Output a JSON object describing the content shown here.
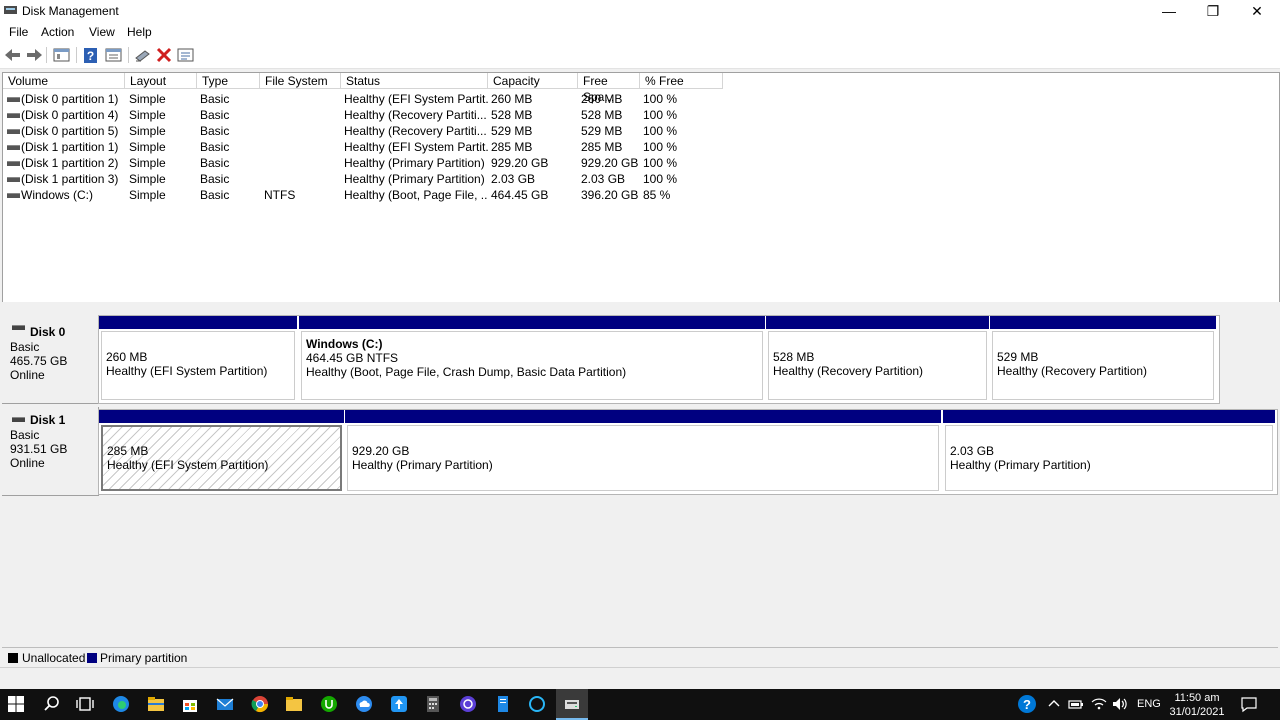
{
  "window": {
    "title": "Disk Management",
    "minimize": "—",
    "restore": "❐",
    "close": "✕"
  },
  "menu": [
    "File",
    "Action",
    "View",
    "Help"
  ],
  "toolbar_icons": [
    "back-icon",
    "forward-icon",
    "console-tree-icon",
    "help-icon",
    "properties-icon",
    "connect-icon",
    "delete-icon",
    "settings-icon"
  ],
  "columns": [
    "Volume",
    "Layout",
    "Type",
    "File System",
    "Status",
    "Capacity",
    "Free Spa...",
    "% Free"
  ],
  "volumes": [
    {
      "volume": "(Disk 0 partition 1)",
      "layout": "Simple",
      "type": "Basic",
      "fs": "",
      "status": "Healthy (EFI System Partit...",
      "capacity": "260 MB",
      "free": "260 MB",
      "pct": "100 %"
    },
    {
      "volume": "(Disk 0 partition 4)",
      "layout": "Simple",
      "type": "Basic",
      "fs": "",
      "status": "Healthy (Recovery Partiti...",
      "capacity": "528 MB",
      "free": "528 MB",
      "pct": "100 %"
    },
    {
      "volume": "(Disk 0 partition 5)",
      "layout": "Simple",
      "type": "Basic",
      "fs": "",
      "status": "Healthy (Recovery Partiti...",
      "capacity": "529 MB",
      "free": "529 MB",
      "pct": "100 %"
    },
    {
      "volume": "(Disk 1 partition 1)",
      "layout": "Simple",
      "type": "Basic",
      "fs": "",
      "status": "Healthy (EFI System Partit...",
      "capacity": "285 MB",
      "free": "285 MB",
      "pct": "100 %"
    },
    {
      "volume": "(Disk 1 partition 2)",
      "layout": "Simple",
      "type": "Basic",
      "fs": "",
      "status": "Healthy (Primary Partition)",
      "capacity": "929.20 GB",
      "free": "929.20 GB",
      "pct": "100 %"
    },
    {
      "volume": "(Disk 1 partition 3)",
      "layout": "Simple",
      "type": "Basic",
      "fs": "",
      "status": "Healthy (Primary Partition)",
      "capacity": "2.03 GB",
      "free": "2.03 GB",
      "pct": "100 %"
    },
    {
      "volume": "Windows (C:)",
      "layout": "Simple",
      "type": "Basic",
      "fs": "NTFS",
      "status": "Healthy (Boot, Page File, ...",
      "capacity": "464.45 GB",
      "free": "396.20 GB",
      "pct": "85 %"
    }
  ],
  "disks": [
    {
      "name": "Disk 0",
      "type": "Basic",
      "size": "465.75 GB",
      "state": "Online",
      "partitions": [
        {
          "title": "",
          "size": "260 MB",
          "status": "Healthy (EFI System Partition)"
        },
        {
          "title": "Windows  (C:)",
          "size": "464.45 GB NTFS",
          "status": "Healthy (Boot, Page File, Crash Dump, Basic Data Partition)"
        },
        {
          "title": "",
          "size": "528 MB",
          "status": "Healthy (Recovery Partition)"
        },
        {
          "title": "",
          "size": "529 MB",
          "status": "Healthy (Recovery Partition)"
        }
      ]
    },
    {
      "name": "Disk 1",
      "type": "Basic",
      "size": "931.51 GB",
      "state": "Online",
      "partitions": [
        {
          "title": "",
          "size": "285 MB",
          "status": "Healthy (EFI System Partition)",
          "selected": true
        },
        {
          "title": "",
          "size": "929.20 GB",
          "status": "Healthy (Primary Partition)"
        },
        {
          "title": "",
          "size": "2.03 GB",
          "status": "Healthy (Primary Partition)"
        }
      ]
    }
  ],
  "legend": [
    {
      "label": "Unallocated",
      "color": "#000000"
    },
    {
      "label": "Primary partition",
      "color": "#000080"
    }
  ],
  "colors": {
    "primary": "#000080",
    "taskbar": "#101010"
  },
  "taskbar": {
    "icons": [
      "start-icon",
      "search-icon",
      "task-view-icon",
      "edge-icon",
      "file-explorer-icon",
      "store-icon",
      "mail-icon",
      "chrome-icon",
      "folder-icon",
      "upwork-icon",
      "cloud-icon",
      "app-store-icon",
      "calculator-icon",
      "app-icon",
      "notepad-icon",
      "cortana-icon",
      "disk-management-icon"
    ],
    "tray_icons": [
      "help-icon",
      "chevron-up-icon",
      "battery-icon",
      "wifi-icon",
      "volume-icon"
    ],
    "language": "ENG",
    "time": "11:50 am",
    "date": "31/01/2021",
    "notification_icon": "notification-icon"
  }
}
